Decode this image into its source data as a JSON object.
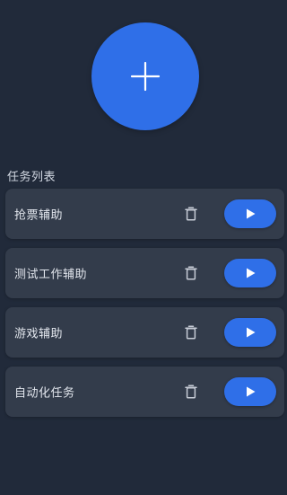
{
  "header": {
    "add_button_icon": "plus-icon",
    "accent_color": "#2f6fe8"
  },
  "section": {
    "title": "任务列表"
  },
  "tasks": [
    {
      "name": "抢票辅助",
      "delete_icon": "trash-icon",
      "run_icon": "play-icon"
    },
    {
      "name": "测试工作辅助",
      "delete_icon": "trash-icon",
      "run_icon": "play-icon"
    },
    {
      "name": "游戏辅助",
      "delete_icon": "trash-icon",
      "run_icon": "play-icon"
    },
    {
      "name": "自动化任务",
      "delete_icon": "trash-icon",
      "run_icon": "play-icon"
    }
  ]
}
